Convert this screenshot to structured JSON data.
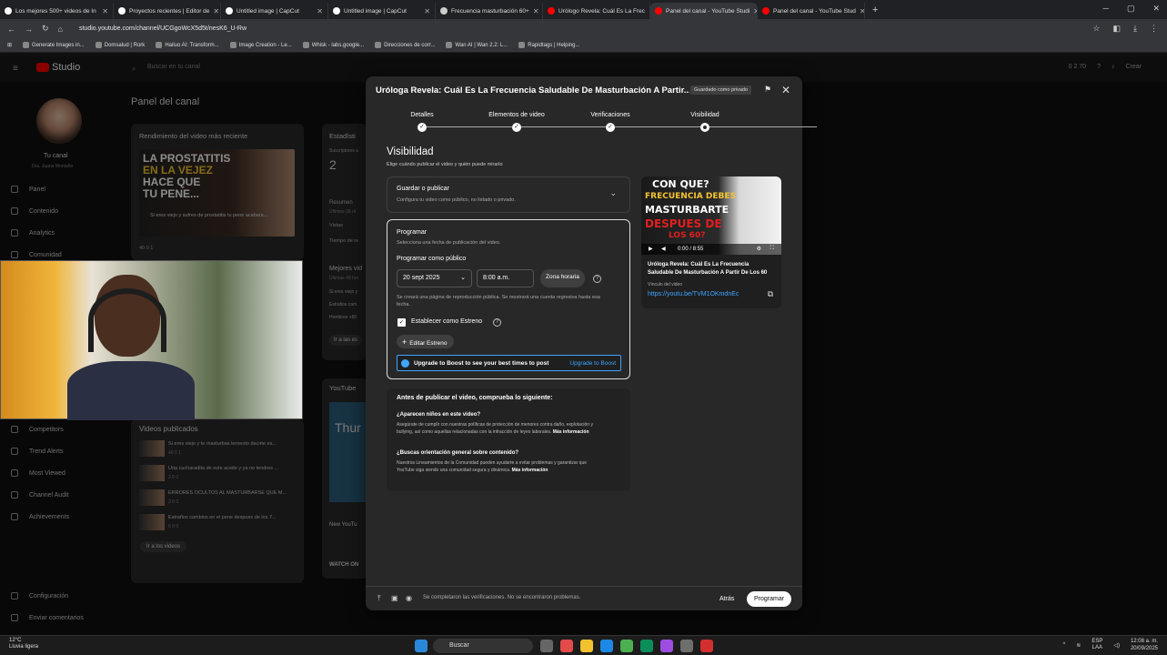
{
  "browser": {
    "tabs": [
      {
        "label": "Los mejores 500+ videos de In",
        "color": "#ffffff"
      },
      {
        "label": "Proyectos recientes | Editor de",
        "color": "#ffffff"
      },
      {
        "label": "Untitled image | CapCut",
        "color": "#ffffff"
      },
      {
        "label": "Untitled image | CapCut",
        "color": "#ffffff"
      },
      {
        "label": "Frecuencia masturbación 60+",
        "color": "#cccccc"
      },
      {
        "label": "Urólogo Revela: Cuál Es La Frec",
        "color": "#ff0000"
      },
      {
        "label": "Panel del canal - YouTube Studi",
        "color": "#ff0000",
        "active": true
      },
      {
        "label": "Panel del canal - YouTube Stud",
        "color": "#ff0000"
      }
    ],
    "new_tab": "+",
    "window_controls": [
      "─",
      "▢",
      "✕"
    ],
    "url": "studio.youtube.com/channel/UCGgoWcX5d5t/nesK6_U-Rw",
    "bookmarks": [
      "Generate Images in...",
      "Domsalud | Rork",
      "Hailuo AI: Transform...",
      "Image Creation - Le...",
      "Whisk - labs.google...",
      "Direcciones de corr...",
      "Wan AI | Wan 2.2: L...",
      "Rapidtags | Helping..."
    ]
  },
  "studio": {
    "logo": "Studio",
    "search_placeholder": "Buscar en tu canal",
    "top_stats": "0  2  70",
    "create": "Crear",
    "panel_title": "Panel del canal",
    "channel_label": "Tu canal",
    "channel_sub": "Dra. Juana Montaño",
    "sidebar": [
      "Panel",
      "Contenido",
      "Analytics",
      "Comunidad"
    ],
    "sidebar_lower": [
      "Competitors",
      "Trend Alerts",
      "Most Viewed",
      "Channel Audit",
      "Achievements"
    ],
    "sidebar_bottom": [
      "Configuración",
      "Enviar comentarios"
    ],
    "latest_card_title": "Rendimiento del video más reciente",
    "latest_thumb_lines": [
      "LA PROSTATITIS",
      "EN LA VEJEZ",
      "HACE QUE",
      "TU PENE..."
    ],
    "latest_thumb_caption": "Si eres viejo y sufres de prostatitis tu pene acabara...",
    "latest_stats": "40   0   1",
    "stats_title": "Estadísti",
    "subs_label": "Suscriptores a",
    "subs_value": "2",
    "summary": [
      "Resumen",
      "Últimos 28 dí",
      "Vistas",
      "Tiempo de re"
    ],
    "best_title": "Mejores víd",
    "best_sub": "Últimas 48 hor",
    "best_items": [
      "Si eres viejo y",
      "Estrafios cam",
      "Hombres +60"
    ],
    "go_btn": "Ir a las es",
    "published_title": "Videos publicados",
    "published": [
      {
        "title": "Si eres viejo y te masturbas lerneoto dacirte es...",
        "stats": "40  0  1"
      },
      {
        "title": "Una cucharadita de este aceite y ya no tendres ...",
        "stats": "2  0  0"
      },
      {
        "title": "ERRORES OCULTOS AL MASTURBARSE QUE M...",
        "stats": "3  0  0"
      },
      {
        "title": "Estraños cambios en el pene despues de los 7...",
        "stats": "6  0  0"
      }
    ],
    "go_videos": "Ir a los videos",
    "yt_title": "YouTube",
    "yt_thumb": "Thur",
    "new_you": "New YouTu",
    "watch": "WATCH ON"
  },
  "modal": {
    "title": "Uróloga Revela: Cuál Es La Frecuencia Saludable De Masturbación A Partir...",
    "badge": "Guardado como privado",
    "steps": [
      "Detalles",
      "Elementos de video",
      "Verificaciones",
      "Visibilidad"
    ],
    "visibility_title": "Visibilidad",
    "visibility_sub": "Elige cuándo publicar el video y quién puede mirarlo",
    "save_title": "Guardar o publicar",
    "save_sub": "Configura tu video como público, no listado o privado.",
    "schedule_title": "Programar",
    "schedule_sub": "Selecciona una fecha de publicación del video.",
    "schedule_public": "Programar como público",
    "date": "20 sept 2025",
    "time": "8:00 a.m.",
    "timezone": "Zona horaria",
    "note": "Se creará una página de reproducción pública. Se mostrará una cuenta regresiva hasta esa fecha.",
    "premiere": "Establecer como Estreno",
    "edit_premiere": "Editar Estreno",
    "boost_text": "Upgrade to Boost to see your best times to post",
    "boost_link": "Upgrade to Boost",
    "check_title": "Antes de publicar el video, comprueba lo siguiente:",
    "q1": "¿Aparecen niños en este video?",
    "p1": "Asegúrate de cumplir con nuestras políticas de protección de menores contra daño, explotación y bullying, así como aquellas relacionadas con la infracción de leyes laborales.",
    "p1_link": "Más información",
    "q2": "¿Buscas orientación general sobre contenido?",
    "p2": "Nuestros Lineamientos de la Comunidad pueden ayudarte a evitar problemas y garantizar que YouTube siga siendo una comunidad segura y dinámica.",
    "p2_link": "Más información",
    "thumb_lines": [
      "CON QUE?",
      "FRECUENCIA DEBES",
      "MASTURBARTE",
      "DESPUES DE",
      "LOS 60?"
    ],
    "video_time": "0:00 / 8:55",
    "preview_title": "Uróloga Revela: Cuál Es La Frecuencia Saludable De Masturbación A Partir De Los 60",
    "link_label": "Vínculo del video",
    "link": "https://youtu.be/TVM1OKmdnEc",
    "footer_msg": "Se completaron las verificaciones. No se encontraron problemas.",
    "back": "Atrás",
    "schedule_btn": "Programar"
  },
  "taskbar": {
    "temp": "12°C",
    "weather": "Lluvia ligera",
    "search": "Buscar",
    "lang": "ESP",
    "lang2": "LAA",
    "time": "12:08 a. m.",
    "date": "20/09/2025"
  }
}
